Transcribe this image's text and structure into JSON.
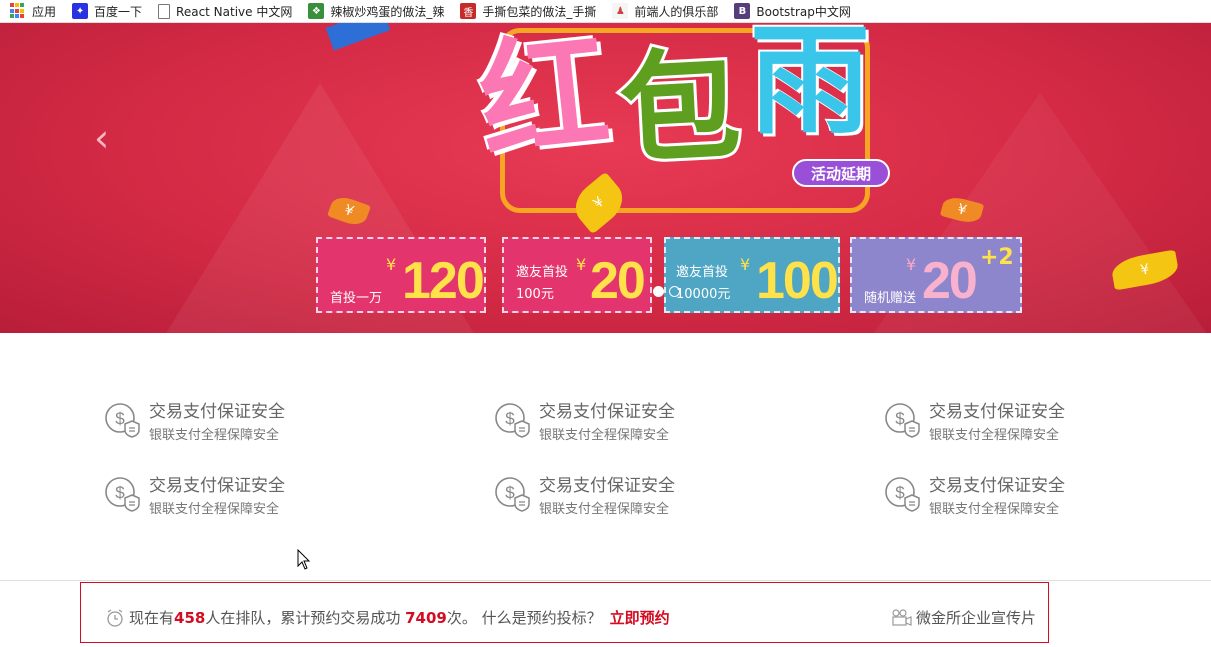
{
  "bookmarks": [
    {
      "label": "应用",
      "icon": "apps-grid-icon"
    },
    {
      "label": "百度一下",
      "icon": "baidu-paw-icon"
    },
    {
      "label": "React Native 中文网",
      "icon": "page-icon"
    },
    {
      "label": "辣椒炒鸡蛋的做法_辣",
      "icon": "recipe-icon"
    },
    {
      "label": "手撕包菜的做法_手撕",
      "icon": "xiang-icon"
    },
    {
      "label": "前端人的俱乐部",
      "icon": "club-icon"
    },
    {
      "label": "Bootstrap中文网",
      "icon": "bootstrap-icon"
    }
  ],
  "banner": {
    "title_chars": [
      "红",
      "包",
      "雨"
    ],
    "badge": "活动延期",
    "leaf_symbol": "¥",
    "prev_symbol": "‹",
    "coupons": [
      {
        "label1": "首投一万",
        "label2": "",
        "currency": "¥",
        "value": "120",
        "extra": "",
        "bg": "#e4346e"
      },
      {
        "label1": "邀友首投",
        "label2": "100元",
        "currency": "¥",
        "value": "20",
        "extra": "",
        "bg": "#e4346e"
      },
      {
        "label1": "邀友首投",
        "label2": "10000元",
        "currency": "¥",
        "value": "100",
        "extra": "",
        "bg": "#4ea5c4"
      },
      {
        "label1": "随机赠送",
        "label2": "",
        "currency": "¥",
        "value": "20",
        "extra": "+2",
        "bg": "#8e86cc"
      }
    ],
    "slides_active": 0
  },
  "features": [
    {
      "title": "交易支付保证安全",
      "sub": "银联支付全程保障安全"
    },
    {
      "title": "交易支付保证安全",
      "sub": "银联支付全程保障安全"
    },
    {
      "title": "交易支付保证安全",
      "sub": "银联支付全程保障安全"
    },
    {
      "title": "交易支付保证安全",
      "sub": "银联支付全程保障安全"
    },
    {
      "title": "交易支付保证安全",
      "sub": "银联支付全程保障安全"
    },
    {
      "title": "交易支付保证安全",
      "sub": "银联支付全程保障安全"
    }
  ],
  "notice": {
    "prefix": "现在有",
    "queue_count": "458",
    "mid1": "人在排队，累计预约交易成功",
    "success_count": "7409",
    "mid2": "次。 什么是预约投标？",
    "cta": "立即预约",
    "video_label": "微金所企业宣传片"
  },
  "colors": {
    "accent": "#d40c22",
    "banner": "#d42a45"
  }
}
